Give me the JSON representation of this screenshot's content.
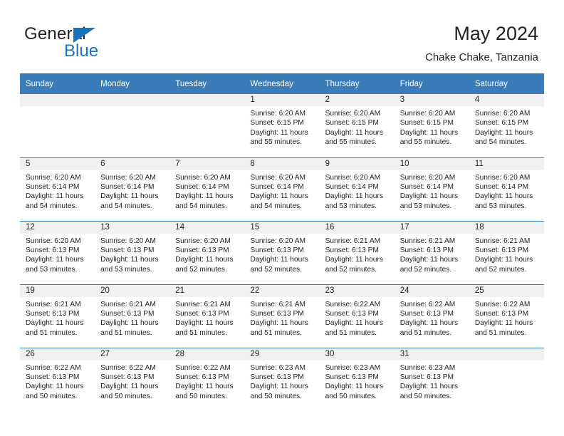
{
  "brand": {
    "word_one": "General",
    "word_two": "Blue",
    "triangle_icon": "blue-triangle-icon",
    "accent_color": "#1b74bb"
  },
  "header": {
    "title": "May 2024",
    "subtitle": "Chake Chake, Tanzania"
  },
  "theme": {
    "header_blue": "#3a7cba",
    "daynum_band": "#f1f1f1",
    "text": "#231f20"
  },
  "calendar": {
    "weekday_headers": [
      "Sunday",
      "Monday",
      "Tuesday",
      "Wednesday",
      "Thursday",
      "Friday",
      "Saturday"
    ],
    "weeks": [
      [
        {
          "day": "",
          "empty": true,
          "lines": []
        },
        {
          "day": "",
          "empty": true,
          "lines": []
        },
        {
          "day": "",
          "empty": true,
          "lines": []
        },
        {
          "day": "1",
          "empty": false,
          "lines": [
            "Sunrise: 6:20 AM",
            "Sunset: 6:15 PM",
            "Daylight: 11 hours",
            "and 55 minutes."
          ]
        },
        {
          "day": "2",
          "empty": false,
          "lines": [
            "Sunrise: 6:20 AM",
            "Sunset: 6:15 PM",
            "Daylight: 11 hours",
            "and 55 minutes."
          ]
        },
        {
          "day": "3",
          "empty": false,
          "lines": [
            "Sunrise: 6:20 AM",
            "Sunset: 6:15 PM",
            "Daylight: 11 hours",
            "and 55 minutes."
          ]
        },
        {
          "day": "4",
          "empty": false,
          "lines": [
            "Sunrise: 6:20 AM",
            "Sunset: 6:15 PM",
            "Daylight: 11 hours",
            "and 54 minutes."
          ]
        }
      ],
      [
        {
          "day": "5",
          "empty": false,
          "lines": [
            "Sunrise: 6:20 AM",
            "Sunset: 6:14 PM",
            "Daylight: 11 hours",
            "and 54 minutes."
          ]
        },
        {
          "day": "6",
          "empty": false,
          "lines": [
            "Sunrise: 6:20 AM",
            "Sunset: 6:14 PM",
            "Daylight: 11 hours",
            "and 54 minutes."
          ]
        },
        {
          "day": "7",
          "empty": false,
          "lines": [
            "Sunrise: 6:20 AM",
            "Sunset: 6:14 PM",
            "Daylight: 11 hours",
            "and 54 minutes."
          ]
        },
        {
          "day": "8",
          "empty": false,
          "lines": [
            "Sunrise: 6:20 AM",
            "Sunset: 6:14 PM",
            "Daylight: 11 hours",
            "and 54 minutes."
          ]
        },
        {
          "day": "9",
          "empty": false,
          "lines": [
            "Sunrise: 6:20 AM",
            "Sunset: 6:14 PM",
            "Daylight: 11 hours",
            "and 53 minutes."
          ]
        },
        {
          "day": "10",
          "empty": false,
          "lines": [
            "Sunrise: 6:20 AM",
            "Sunset: 6:14 PM",
            "Daylight: 11 hours",
            "and 53 minutes."
          ]
        },
        {
          "day": "11",
          "empty": false,
          "lines": [
            "Sunrise: 6:20 AM",
            "Sunset: 6:14 PM",
            "Daylight: 11 hours",
            "and 53 minutes."
          ]
        }
      ],
      [
        {
          "day": "12",
          "empty": false,
          "lines": [
            "Sunrise: 6:20 AM",
            "Sunset: 6:13 PM",
            "Daylight: 11 hours",
            "and 53 minutes."
          ]
        },
        {
          "day": "13",
          "empty": false,
          "lines": [
            "Sunrise: 6:20 AM",
            "Sunset: 6:13 PM",
            "Daylight: 11 hours",
            "and 53 minutes."
          ]
        },
        {
          "day": "14",
          "empty": false,
          "lines": [
            "Sunrise: 6:20 AM",
            "Sunset: 6:13 PM",
            "Daylight: 11 hours",
            "and 52 minutes."
          ]
        },
        {
          "day": "15",
          "empty": false,
          "lines": [
            "Sunrise: 6:20 AM",
            "Sunset: 6:13 PM",
            "Daylight: 11 hours",
            "and 52 minutes."
          ]
        },
        {
          "day": "16",
          "empty": false,
          "lines": [
            "Sunrise: 6:21 AM",
            "Sunset: 6:13 PM",
            "Daylight: 11 hours",
            "and 52 minutes."
          ]
        },
        {
          "day": "17",
          "empty": false,
          "lines": [
            "Sunrise: 6:21 AM",
            "Sunset: 6:13 PM",
            "Daylight: 11 hours",
            "and 52 minutes."
          ]
        },
        {
          "day": "18",
          "empty": false,
          "lines": [
            "Sunrise: 6:21 AM",
            "Sunset: 6:13 PM",
            "Daylight: 11 hours",
            "and 52 minutes."
          ]
        }
      ],
      [
        {
          "day": "19",
          "empty": false,
          "lines": [
            "Sunrise: 6:21 AM",
            "Sunset: 6:13 PM",
            "Daylight: 11 hours",
            "and 51 minutes."
          ]
        },
        {
          "day": "20",
          "empty": false,
          "lines": [
            "Sunrise: 6:21 AM",
            "Sunset: 6:13 PM",
            "Daylight: 11 hours",
            "and 51 minutes."
          ]
        },
        {
          "day": "21",
          "empty": false,
          "lines": [
            "Sunrise: 6:21 AM",
            "Sunset: 6:13 PM",
            "Daylight: 11 hours",
            "and 51 minutes."
          ]
        },
        {
          "day": "22",
          "empty": false,
          "lines": [
            "Sunrise: 6:21 AM",
            "Sunset: 6:13 PM",
            "Daylight: 11 hours",
            "and 51 minutes."
          ]
        },
        {
          "day": "23",
          "empty": false,
          "lines": [
            "Sunrise: 6:22 AM",
            "Sunset: 6:13 PM",
            "Daylight: 11 hours",
            "and 51 minutes."
          ]
        },
        {
          "day": "24",
          "empty": false,
          "lines": [
            "Sunrise: 6:22 AM",
            "Sunset: 6:13 PM",
            "Daylight: 11 hours",
            "and 51 minutes."
          ]
        },
        {
          "day": "25",
          "empty": false,
          "lines": [
            "Sunrise: 6:22 AM",
            "Sunset: 6:13 PM",
            "Daylight: 11 hours",
            "and 51 minutes."
          ]
        }
      ],
      [
        {
          "day": "26",
          "empty": false,
          "lines": [
            "Sunrise: 6:22 AM",
            "Sunset: 6:13 PM",
            "Daylight: 11 hours",
            "and 50 minutes."
          ]
        },
        {
          "day": "27",
          "empty": false,
          "lines": [
            "Sunrise: 6:22 AM",
            "Sunset: 6:13 PM",
            "Daylight: 11 hours",
            "and 50 minutes."
          ]
        },
        {
          "day": "28",
          "empty": false,
          "lines": [
            "Sunrise: 6:22 AM",
            "Sunset: 6:13 PM",
            "Daylight: 11 hours",
            "and 50 minutes."
          ]
        },
        {
          "day": "29",
          "empty": false,
          "lines": [
            "Sunrise: 6:23 AM",
            "Sunset: 6:13 PM",
            "Daylight: 11 hours",
            "and 50 minutes."
          ]
        },
        {
          "day": "30",
          "empty": false,
          "lines": [
            "Sunrise: 6:23 AM",
            "Sunset: 6:13 PM",
            "Daylight: 11 hours",
            "and 50 minutes."
          ]
        },
        {
          "day": "31",
          "empty": false,
          "lines": [
            "Sunrise: 6:23 AM",
            "Sunset: 6:13 PM",
            "Daylight: 11 hours",
            "and 50 minutes."
          ]
        },
        {
          "day": "",
          "empty": true,
          "lines": []
        }
      ]
    ]
  }
}
